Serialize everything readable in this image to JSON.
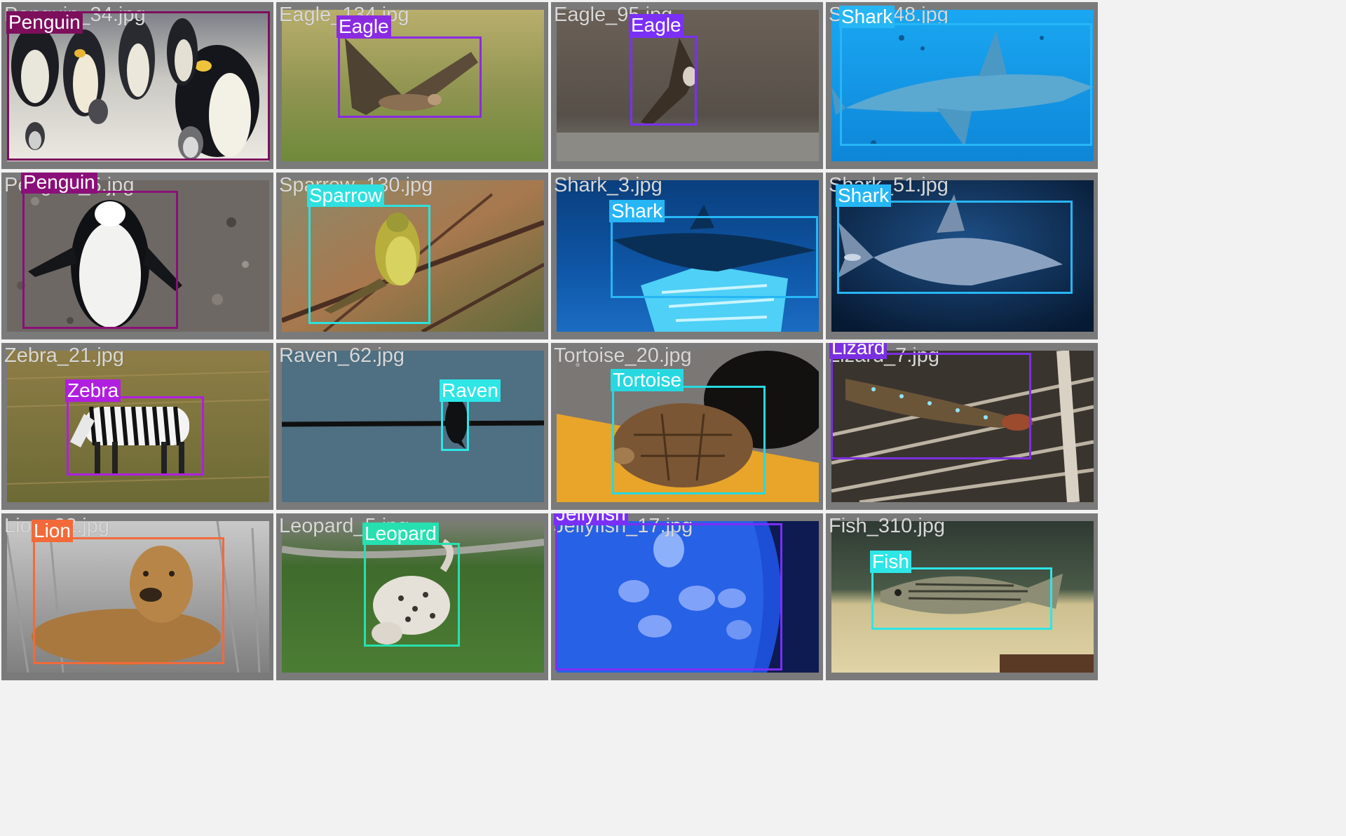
{
  "grid": {
    "cells": [
      {
        "filename": "Penguin_34.jpg",
        "label": "Penguin",
        "color": "#7d0f5c",
        "scene": "penguin_colony"
      },
      {
        "filename": "Eagle_134.jpg",
        "label": "Eagle",
        "color": "#8a2be2",
        "scene": "eagle_field"
      },
      {
        "filename": "Eagle_95.jpg",
        "label": "Eagle",
        "color": "#7b2ff7",
        "scene": "eagle_dusk"
      },
      {
        "filename": "Shark_48.jpg",
        "label": "Shark",
        "color": "#27b6f5",
        "scene": "shark_bright"
      },
      {
        "filename": "Penguin_5.jpg",
        "label": "Penguin",
        "color": "#8b0f78",
        "scene": "penguin_rocks"
      },
      {
        "filename": "Sparrow_130.jpg",
        "label": "Sparrow",
        "color": "#2fe0e0",
        "scene": "sparrow_branch"
      },
      {
        "filename": "Shark_3.jpg",
        "label": "Shark",
        "color": "#27b6f5",
        "scene": "shark_tank"
      },
      {
        "filename": "Shark_51.jpg",
        "label": "Shark",
        "color": "#27b6f5",
        "scene": "shark_dark"
      },
      {
        "filename": "Zebra_21.jpg",
        "label": "Zebra",
        "color": "#b01fe0",
        "scene": "zebra_grass"
      },
      {
        "filename": "Raven_62.jpg",
        "label": "Raven",
        "color": "#2ee6e6",
        "scene": "raven_wire"
      },
      {
        "filename": "Tortoise_20.jpg",
        "label": "Tortoise",
        "color": "#27d8e0",
        "scene": "tortoise"
      },
      {
        "filename": "Lizard_7.jpg",
        "label": "Lizard",
        "color": "#7a2fe0",
        "scene": "lizard_thatch"
      },
      {
        "filename": "Lion_22.jpg",
        "label": "Lion",
        "color": "#f26a3a",
        "scene": "lion_grass"
      },
      {
        "filename": "Leopard_5.jpg",
        "label": "Leopard",
        "color": "#27e0b0",
        "scene": "leopard_grass"
      },
      {
        "filename": "Jellyfish_17.jpg",
        "label": "Jellyfish",
        "color": "#7a2ff7",
        "scene": "jellyfish_tank"
      },
      {
        "filename": "Fish_310.jpg",
        "label": "Fish",
        "color": "#2ee6e6",
        "scene": "fish_gravel"
      }
    ]
  }
}
